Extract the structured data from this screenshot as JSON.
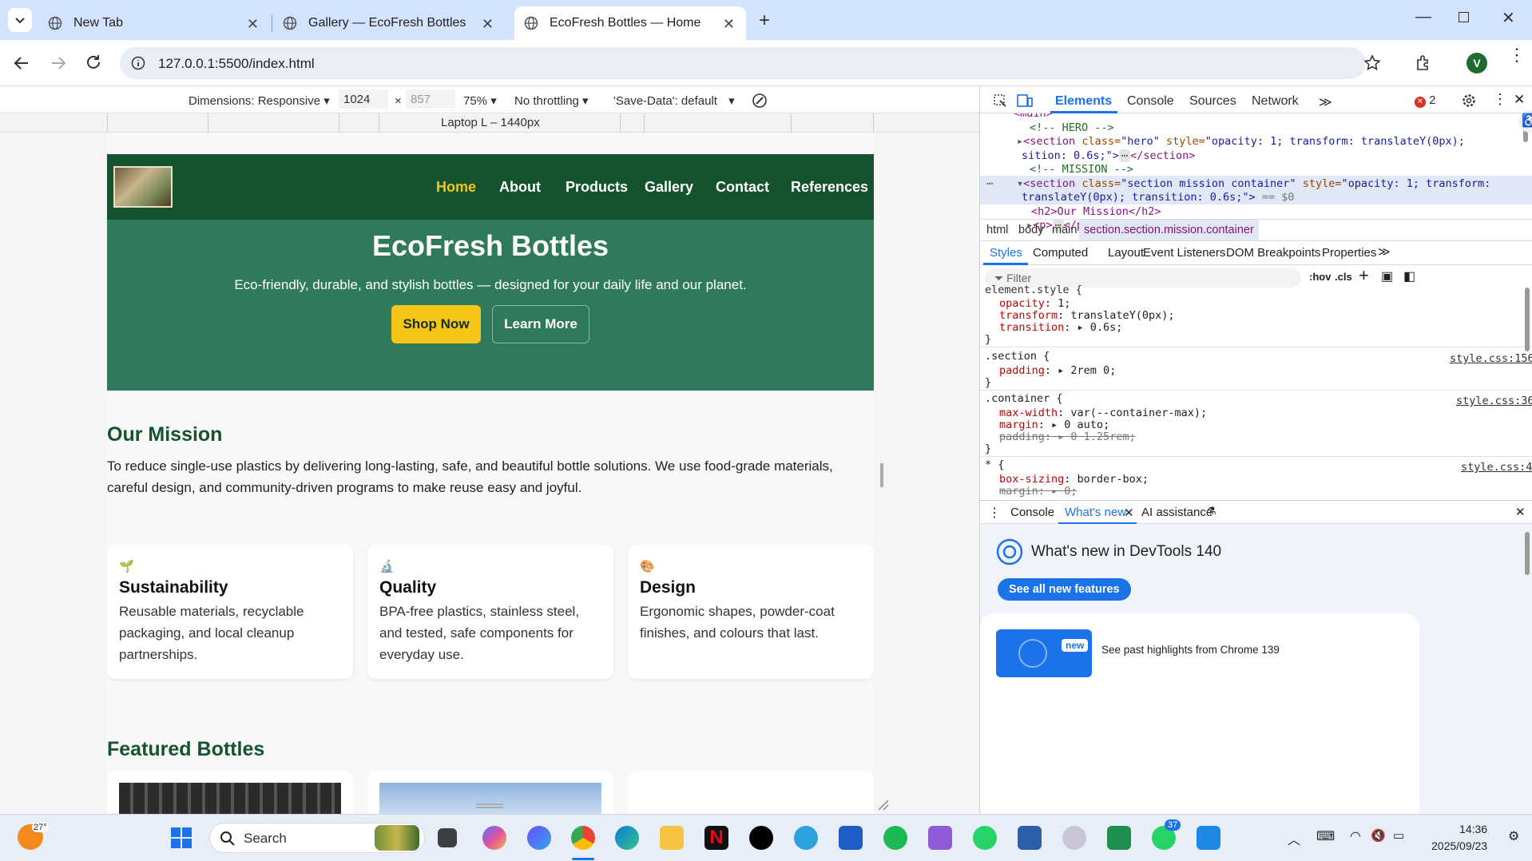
{
  "browser": {
    "tabs": [
      {
        "title": "New Tab",
        "active": false
      },
      {
        "title": "Gallery — EcoFresh Bottles",
        "active": false
      },
      {
        "title": "EcoFresh Bottles — Home",
        "active": true
      }
    ],
    "url": "127.0.0.1:5500/index.html",
    "profile_initial": "V"
  },
  "device_toolbar": {
    "dimensions_label": "Dimensions: Responsive",
    "width": "1024",
    "height": "857",
    "times": "×",
    "zoom": "75%",
    "throttling": "No throttling",
    "save_data": "'Save-Data': default",
    "ruler_label": "Laptop L – 1440px"
  },
  "site": {
    "nav": [
      "Home",
      "About",
      "Products",
      "Gallery",
      "Contact",
      "References"
    ],
    "hero": {
      "title": "EcoFresh Bottles",
      "subtitle": "Eco-friendly, durable, and stylish bottles — designed for your daily life and our planet.",
      "primary_cta": "Shop Now",
      "secondary_cta": "Learn More"
    },
    "mission": {
      "heading": "Our Mission",
      "text": "To reduce single-use plastics by delivering long-lasting, safe, and beautiful bottle solutions. We use food-grade materials, careful design, and community-driven programs to make reuse easy and joyful."
    },
    "cards": [
      {
        "icon": "🌱",
        "title": "Sustainability",
        "text": "Reusable materials, recyclable packaging, and local cleanup partnerships."
      },
      {
        "icon": "🔬",
        "title": "Quality",
        "text": "BPA-free plastics, stainless steel, and tested, safe components for everyday use."
      },
      {
        "icon": "🎨",
        "title": "Design",
        "text": "Ergonomic shapes, powder-coat finishes, and colours that last."
      }
    ],
    "featured_heading": "Featured Bottles",
    "colors": {
      "nav": "#14532d",
      "hero": "#2e7a5a",
      "accent": "#f5c518",
      "heading": "#14532d"
    }
  },
  "devtools": {
    "tabs": [
      "Elements",
      "Console",
      "Sources",
      "Network"
    ],
    "error_count": "2",
    "dom": {
      "main_tag": "<main>",
      "hero_comment": "<!-- HERO -->",
      "hero_open": "<section",
      "hero_class_attr": "class=",
      "hero_class_val": "\"hero\"",
      "hero_style_attr": "style=",
      "hero_style_val": "\"opacity: 1; transform: translateY(0px);",
      "hero_wrap": "sition: 0.6s;\">",
      "hero_close": "</section>",
      "mission_comment": "<!-- MISSION -->",
      "mission_open": "<section",
      "mission_class_attr": "class=",
      "mission_class_val": "\"section mission container\"",
      "mission_style_attr": "style=",
      "mission_style_val": "\"opacity: 1; transform:",
      "mission_wrap": "translateY(0px); transition: 0.6s;\">",
      "mission_eq": "== $0",
      "h2_line": "<h2>Our Mission</h2>",
      "p_line": "<p>",
      "p_close": "</p>"
    },
    "breadcrumbs": [
      "html",
      "body",
      "main",
      "section.section.mission.container"
    ],
    "subtabs": [
      "Styles",
      "Computed",
      "Layout",
      "Event Listeners",
      "DOM Breakpoints",
      "Properties"
    ],
    "filter_placeholder": "Filter",
    "hov": ":hov",
    "cls": ".cls",
    "rules": {
      "element_selector": "element.style {",
      "opacity": [
        "opacity",
        "1;"
      ],
      "transform": [
        "transform",
        "translateY(0px);"
      ],
      "transition": [
        "transition",
        "0.6s;"
      ],
      "section_selector": ".section {",
      "section_source": "style.css:156",
      "section_padding": [
        "padding",
        "2rem 0;"
      ],
      "container_selector": ".container {",
      "container_source": "style.css:36",
      "container_maxwidth": [
        "max-width",
        "var(--container-max);"
      ],
      "container_margin": [
        "margin",
        "0 auto;"
      ],
      "container_padding": [
        "padding",
        "0 1.25rem;"
      ],
      "star_selector": "* {",
      "star_source": "style.css:4",
      "star_boxsizing": [
        "box-sizing",
        "border-box;"
      ],
      "star_margin": [
        "margin",
        "0;"
      ],
      "close_brace": "}"
    },
    "drawer": {
      "tabs": [
        "Console",
        "What's new",
        "AI assistance"
      ],
      "title": "What's new in DevTools 140",
      "button": "See all new features",
      "badge": "new",
      "highlight": "See past highlights from Chrome 139"
    }
  },
  "taskbar": {
    "weather": "27°",
    "search": "Search",
    "time": "14:36",
    "date": "2025/09/23",
    "telegram_badge": "37"
  }
}
